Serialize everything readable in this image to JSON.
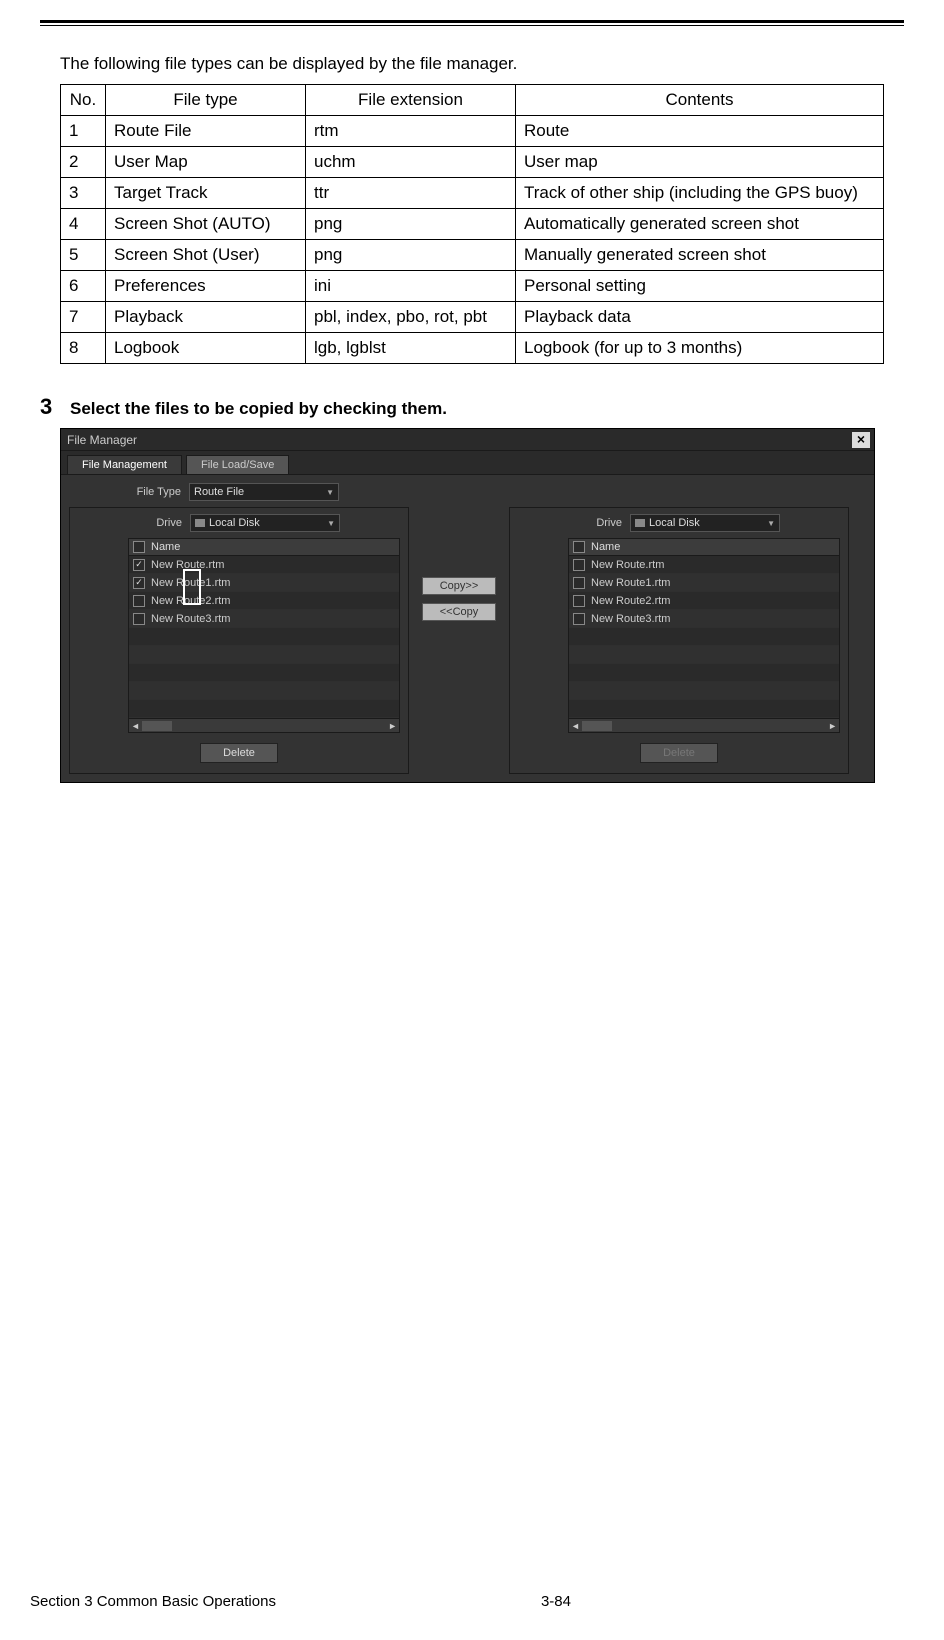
{
  "intro": "The following file types can be displayed by the file manager.",
  "table": {
    "headers": {
      "no": "No.",
      "filetype": "File type",
      "ext": "File extension",
      "contents": "Contents"
    },
    "rows": [
      {
        "no": "1",
        "filetype": "Route File",
        "ext": "rtm",
        "contents": "Route"
      },
      {
        "no": "2",
        "filetype": "User Map",
        "ext": "uchm",
        "contents": "User map"
      },
      {
        "no": "3",
        "filetype": "Target Track",
        "ext": "ttr",
        "contents": "Track of other ship (including the GPS buoy)"
      },
      {
        "no": "4",
        "filetype": "Screen Shot (AUTO)",
        "ext": "png",
        "contents": "Automatically generated screen shot"
      },
      {
        "no": "5",
        "filetype": "Screen Shot (User)",
        "ext": "png",
        "contents": "Manually generated screen shot"
      },
      {
        "no": "6",
        "filetype": "Preferences",
        "ext": "ini",
        "contents": "Personal setting"
      },
      {
        "no": "7",
        "filetype": "Playback",
        "ext": "pbl, index, pbo, rot, pbt",
        "contents": "Playback data"
      },
      {
        "no": "8",
        "filetype": "Logbook",
        "ext": "lgb, lgblst",
        "contents": "Logbook (for up to 3 months)"
      }
    ]
  },
  "step": {
    "num": "3",
    "text": "Select the files to be copied by checking them."
  },
  "fm": {
    "title": "File Manager",
    "tabs": {
      "mgmt": "File Management",
      "load": "File Load/Save"
    },
    "filetype_label": "File Type",
    "filetype_value": "Route File",
    "drive_label": "Drive",
    "drive_value": "Local Disk",
    "name_header": "Name",
    "copy_right": "Copy>>",
    "copy_left": "<<Copy",
    "delete": "Delete",
    "left_files": [
      {
        "name": "New Route.rtm",
        "checked": true
      },
      {
        "name": "New Route1.rtm",
        "checked": true
      },
      {
        "name": "New Route2.rtm",
        "checked": false
      },
      {
        "name": "New Route3.rtm",
        "checked": false
      }
    ],
    "right_files": [
      {
        "name": "New Route.rtm",
        "checked": false
      },
      {
        "name": "New Route1.rtm",
        "checked": false
      },
      {
        "name": "New Route2.rtm",
        "checked": false
      },
      {
        "name": "New Route3.rtm",
        "checked": false
      }
    ]
  },
  "footer": {
    "section": "Section 3    Common Basic Operations",
    "page": "3-84"
  }
}
